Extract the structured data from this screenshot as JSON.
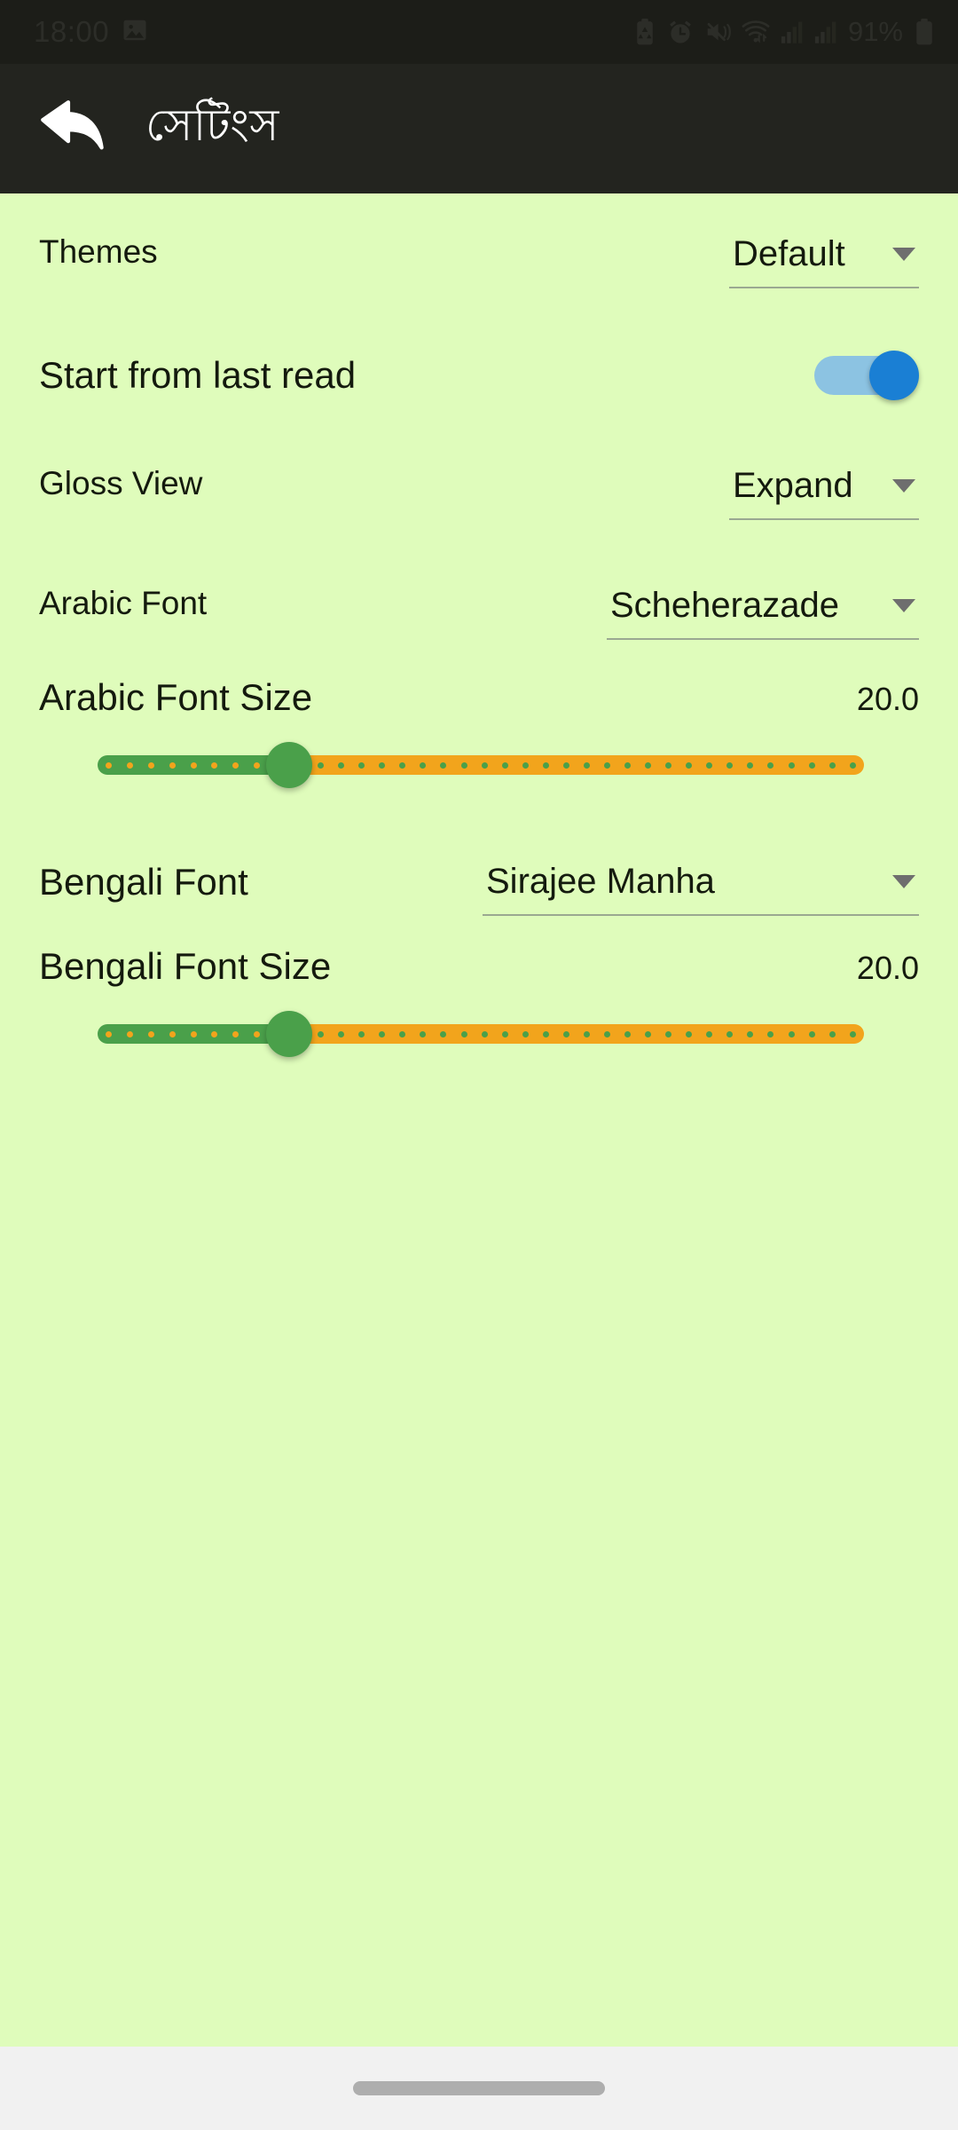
{
  "status_bar": {
    "time": "18:00",
    "battery_percent": "91%",
    "icons": [
      "screenshot-icon",
      "battery-saver-icon",
      "alarm-icon",
      "vibrate-icon",
      "wifi-icon",
      "signal-bars-icon",
      "signal-bars-2-icon",
      "battery-icon"
    ]
  },
  "app_bar": {
    "title": "সেটিংস",
    "back_icon": "back-arrow-icon"
  },
  "colors": {
    "background": "#dffcbb",
    "app_bar": "#23241f",
    "status_bar": "#1c1d18",
    "toggle_on": "#1a7fd4",
    "toggle_track": "#8cc3e2",
    "slider_active": "#4aa04a",
    "slider_inactive": "#f2a41c",
    "text": "#141a0e"
  },
  "settings": {
    "themes": {
      "label": "Themes",
      "value": "Default"
    },
    "start_from_last_read": {
      "label": "Start from last read",
      "state": "on"
    },
    "gloss_view": {
      "label": "Gloss View",
      "value": "Expand"
    },
    "arabic_font": {
      "label": "Arabic Font",
      "value": "Scheherazade"
    },
    "arabic_font_size": {
      "label": "Arabic Font Size",
      "value": "20.0",
      "fill_percent": 25
    },
    "bengali_font": {
      "label": "Bengali Font",
      "value": "Sirajee Manha"
    },
    "bengali_font_size": {
      "label": "Bengali Font Size",
      "value": "20.0",
      "fill_percent": 25
    }
  },
  "nav_bar": {
    "gesture_pill": "home-gesture-pill"
  }
}
